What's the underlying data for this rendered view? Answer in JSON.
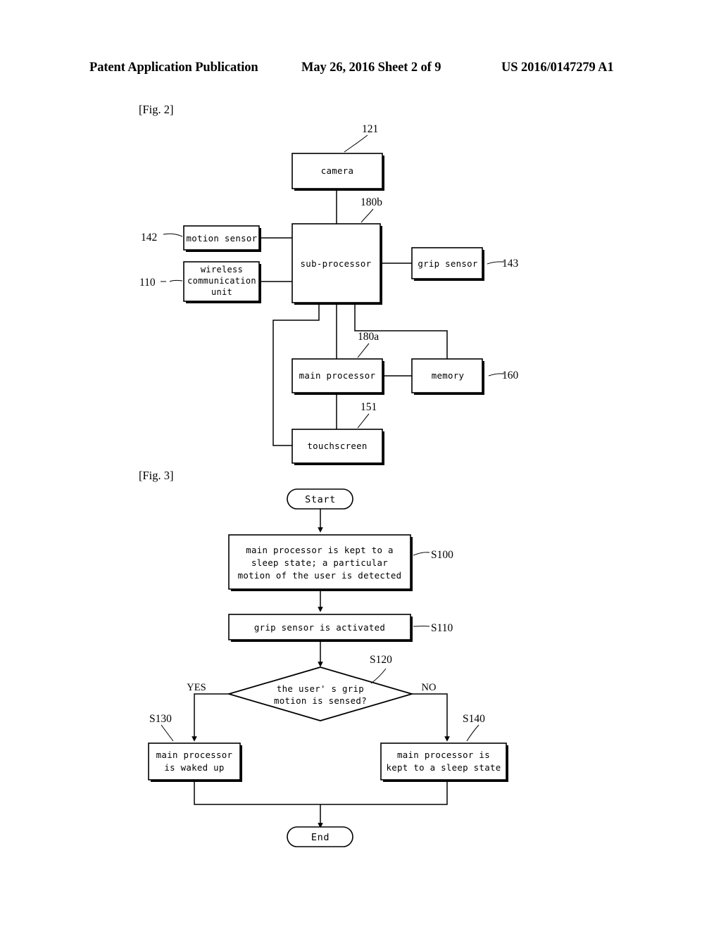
{
  "header": {
    "left": "Patent Application Publication",
    "middle": "May 26, 2016  Sheet 2 of 9",
    "right": "US 2016/0147279 A1"
  },
  "figures": [
    {
      "label": "[Fig. 2]",
      "type": "block-diagram",
      "blocks": [
        {
          "id": "camera",
          "label": "camera",
          "ref": "121"
        },
        {
          "id": "sub-processor",
          "label": "sub-processor",
          "ref": "180b"
        },
        {
          "id": "motion-sensor",
          "label": "motion sensor",
          "ref": "142"
        },
        {
          "id": "wireless-communication-unit",
          "label_lines": [
            "wireless",
            "communication",
            "unit"
          ],
          "ref": "110"
        },
        {
          "id": "grip-sensor",
          "label": "grip sensor",
          "ref": "143"
        },
        {
          "id": "main-processor",
          "label": "main processor",
          "ref": "180a"
        },
        {
          "id": "memory",
          "label": "memory",
          "ref": "160"
        },
        {
          "id": "touchscreen",
          "label": "touchscreen",
          "ref": "151"
        }
      ],
      "connections": [
        {
          "from": "camera",
          "to": "sub-processor"
        },
        {
          "from": "motion-sensor",
          "to": "sub-processor"
        },
        {
          "from": "wireless-communication-unit",
          "to": "sub-processor"
        },
        {
          "from": "sub-processor",
          "to": "grip-sensor"
        },
        {
          "from": "sub-processor",
          "to": "main-processor"
        },
        {
          "from": "sub-processor",
          "to": "memory"
        },
        {
          "from": "sub-processor",
          "to": "touchscreen"
        },
        {
          "from": "main-processor",
          "to": "memory"
        },
        {
          "from": "main-processor",
          "to": "touchscreen"
        }
      ]
    },
    {
      "label": "[Fig. 3]",
      "type": "flowchart",
      "nodes": [
        {
          "id": "start",
          "shape": "terminator",
          "label": "Start"
        },
        {
          "id": "s100",
          "shape": "process",
          "ref": "S100",
          "label_lines": [
            "main processor is kept to a",
            "sleep state; a particular",
            "motion of the user is detected"
          ]
        },
        {
          "id": "s110",
          "shape": "process",
          "ref": "S110",
          "label": "grip sensor is activated"
        },
        {
          "id": "s120",
          "shape": "decision",
          "ref": "S120",
          "label_lines": [
            "the user' s grip",
            "motion is sensed?"
          ],
          "branch_yes": "YES",
          "branch_no": "NO"
        },
        {
          "id": "s130",
          "shape": "process",
          "ref": "S130",
          "label_lines": [
            "main processor",
            "is waked up"
          ]
        },
        {
          "id": "s140",
          "shape": "process",
          "ref": "S140",
          "label_lines": [
            "main processor is",
            "kept to a sleep state"
          ]
        },
        {
          "id": "end",
          "shape": "terminator",
          "label": "End"
        }
      ],
      "edges": [
        {
          "from": "start",
          "to": "s100"
        },
        {
          "from": "s100",
          "to": "s110"
        },
        {
          "from": "s110",
          "to": "s120"
        },
        {
          "from": "s120",
          "to": "s130",
          "label": "YES"
        },
        {
          "from": "s120",
          "to": "s140",
          "label": "NO"
        },
        {
          "from": "s130",
          "to": "end"
        },
        {
          "from": "s140",
          "to": "end"
        }
      ]
    }
  ],
  "colors": {
    "ink": "#000000",
    "paper": "#ffffff"
  }
}
